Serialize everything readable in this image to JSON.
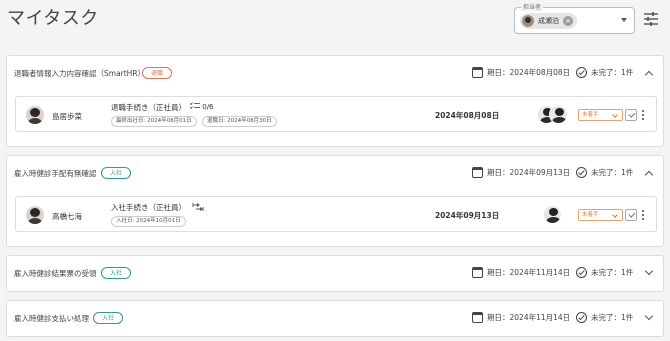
{
  "page": {
    "title": "マイタスク"
  },
  "assignee_filter": {
    "label": "担当者",
    "selected": "成瀬泊"
  },
  "sections": [
    {
      "title": "退職者情報入力内容確認（SmartHR）",
      "tag": "退職",
      "due": "期日：2024年08月08日",
      "incomplete": "未完了：1件",
      "expanded": true,
      "task": {
        "person": "島居歩菜",
        "procedure": "退職手続き（正社員）",
        "subtask_progress": "0/6",
        "pill1": "最終出社日: 2024年08月01日",
        "pill2": "退職日: 2024年08月30日",
        "date": "2024年08月08日",
        "status": "未着手"
      }
    },
    {
      "title": "雇入時健診手配有無確認",
      "tag": "入社",
      "due": "期日：2024年09月13日",
      "incomplete": "未完了：1件",
      "expanded": true,
      "task": {
        "person": "高橋七海",
        "procedure": "入社手続き（正社員）",
        "pill1": "入社日: 2024年10月01日",
        "date": "2024年09月13日",
        "status": "未着手"
      }
    },
    {
      "title": "雇入時健診結果票の受領",
      "tag": "入社",
      "due": "期日：2024年11月14日",
      "incomplete": "未完了：1件",
      "expanded": false
    },
    {
      "title": "雇入時健診支払い処理",
      "tag": "入社",
      "due": "期日：2024年11月14日",
      "incomplete": "未完了：1件",
      "expanded": false
    }
  ],
  "colors": {
    "retire_tag": "#e76f51",
    "join_tag": "#2a9d8f",
    "status": "#d9823f"
  },
  "icons": [
    "filter-settings-icon",
    "calendar-icon",
    "check-circle-icon",
    "chevron-up-icon",
    "chevron-down-icon",
    "subtask-list-icon",
    "sequence-icon",
    "kebab-menu-icon"
  ]
}
